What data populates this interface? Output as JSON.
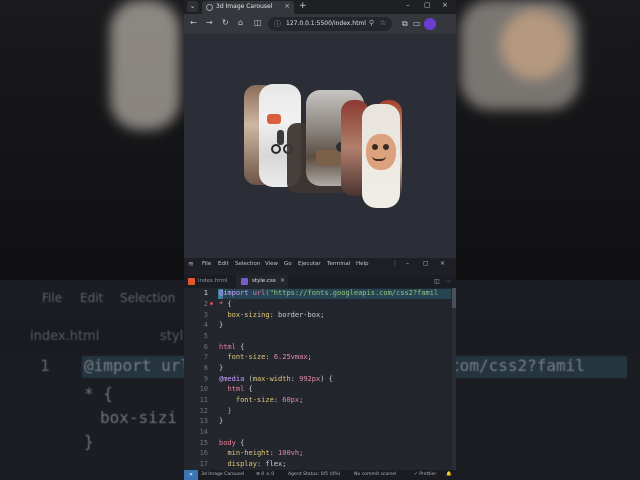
{
  "browser": {
    "tab_dropdown_glyph": "⌄",
    "tab_title": "3d Image Carousel",
    "tab_close_glyph": "×",
    "new_tab_glyph": "+",
    "window_controls": [
      "–",
      "▢",
      "×"
    ],
    "nav": {
      "back": "←",
      "forward": "→",
      "reload": "↻",
      "home": "⌂",
      "split": "◫"
    },
    "url": "127.0.0.1:5500/index.html",
    "url_icon": "ⓘ",
    "zoom_icon": "⚲",
    "star_icon": "☆",
    "extensions_icon": "⧉",
    "sidebar_icon": "▭"
  },
  "background": {
    "menu": [
      "File",
      "Edit",
      "Selection"
    ],
    "tabs": [
      "index.html",
      "styl"
    ],
    "line_number": "1",
    "line_code": "@import url(\"https://fonts.googleapis.com/css2?famil",
    "line2": "* {",
    "line3": "box-sizi",
    "line4": "}"
  },
  "vscode": {
    "logo_glyph": "≋",
    "menu": [
      "File",
      "Edit",
      "Selection",
      "View",
      "Go",
      "Ejecutar",
      "Terminal",
      "Help"
    ],
    "menu_more": "⋮",
    "window_controls": [
      "–",
      "▢",
      "×"
    ],
    "tabs": [
      {
        "label": "index.html"
      },
      {
        "label": "style.css"
      }
    ],
    "tab_close_glyph": "×",
    "split_glyph": "◫",
    "more_glyph": "⋯",
    "line_numbers": [
      "1",
      "2",
      "3",
      "4",
      "5",
      "6",
      "7",
      "8",
      "9",
      "10",
      "11",
      "12",
      "13",
      "14",
      "15",
      "16",
      "17"
    ],
    "status": {
      "remote": "✕",
      "project": "3d Image Carousel",
      "problems": "⊗ 0 ⚠ 0",
      "agent": "Agent Status: 0/5 (0%)",
      "commit": "No commit scored",
      "formatter": "✓ Prettier",
      "bell": "🔔"
    }
  }
}
